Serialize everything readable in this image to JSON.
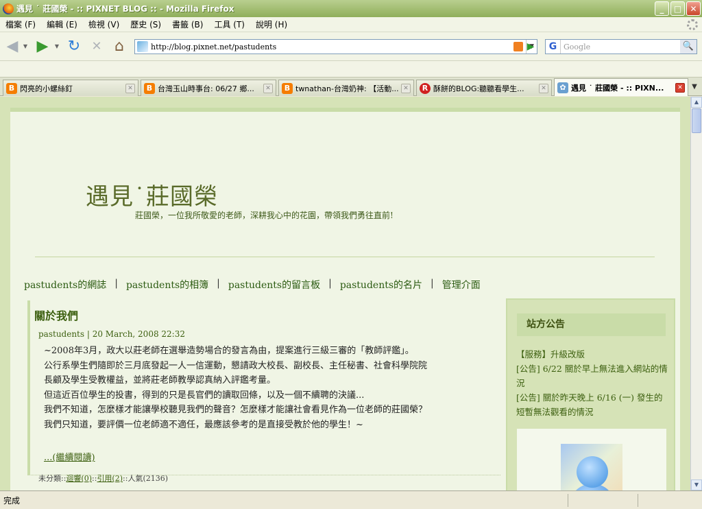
{
  "window": {
    "title": "遇見 ˙ 莊國榮 - :: PIXNET BLOG :: - Mozilla Firefox",
    "minimize": "_",
    "maximize": "□",
    "close": "✕"
  },
  "menu": [
    "檔案 (F)",
    "編輯 (E)",
    "檢視 (V)",
    "歷史 (S)",
    "書籤 (B)",
    "工具 (T)",
    "說明 (H)"
  ],
  "toolbar": {
    "back": "◀",
    "forward": "▶",
    "reload": "↻",
    "stop": "✕",
    "home": "⌂",
    "url": "http://blog.pixnet.net/pastudents",
    "url_dropdown": "▼",
    "go": "▶",
    "search_engine": "G",
    "search_placeholder": "Google",
    "search_button": "🔍"
  },
  "tabs": [
    {
      "title": "閃亮的小螺絲釘",
      "icon": "blogger-icon",
      "color": "#f57d00",
      "glyph": "B"
    },
    {
      "title": "台灣玉山時事台: 06/27 鄉...",
      "icon": "blogger-icon",
      "color": "#f57d00",
      "glyph": "B"
    },
    {
      "title": "twnathan-台灣奶神: 【活動...",
      "icon": "blogger-icon",
      "color": "#f57d00",
      "glyph": "B"
    },
    {
      "title": "酥餅的BLOG:聽聽看學生...",
      "icon": "r-icon",
      "color": "#d02020",
      "glyph": "R"
    },
    {
      "title": "遇見 ˙ 莊國榮 - :: PIXN...",
      "icon": "pixnet-icon",
      "color": "#6aa0d0",
      "glyph": "✿"
    }
  ],
  "blog": {
    "title": "遇見˙莊國榮",
    "description": "莊國榮，一位我所敬愛的老師，深耕我心中的花園，帶領我們勇往直前!",
    "nav": [
      "pastudents的網誌",
      "pastudents的相簿",
      "pastudents的留言板",
      "pastudents的名片",
      "管理介面"
    ],
    "nav_sep": "|"
  },
  "post": {
    "title": "關於我們",
    "meta": "pastudents | 20 March, 2008 22:32",
    "lines": [
      "~2008年3月，政大以莊老師在選舉造勢場合的發言為由，提案進行三級三審的「教師評鑑」。",
      "公行系學生們隨即於三月底發起一人一信運動，懇請政大校長、副校長、主任秘書、社會科學院院",
      "長顧及學生受教權益，並將莊老師教學認真納入評鑑考量。",
      "但這近百位學生的投書，得到的只是長官們的讀取回條，以及一個不續聘的決議...",
      "我們不知道，怎麼樣才能讓學校聽見我們的聲音？怎麼樣才能讓社會看見作為一位老師的莊國榮？",
      "我們只知道，要評價一位老師適不適任，最應該參考的是直接受教於他的學生！~"
    ],
    "read_more": "...(繼續閱讀)",
    "footer_category": "未分類::",
    "footer_reply": "迴響(0)",
    "footer_sep1": "::",
    "footer_trackback": "引用(2)",
    "footer_views": "::人氣(2136)"
  },
  "sidebar": {
    "heading": "站方公告",
    "items": [
      "【服務】升級改版",
      "[公告] 6/22 關於早上無法進入網站的情況",
      "[公告] 關於昨天晚上 6/16 (一) 發生的短暫無法觀看的情況"
    ]
  },
  "status": {
    "text": "完成"
  }
}
